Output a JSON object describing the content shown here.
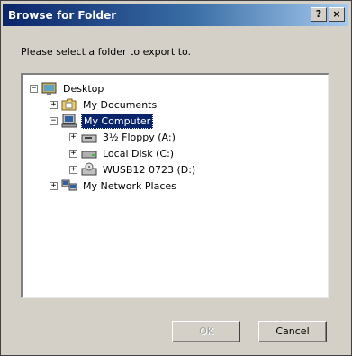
{
  "window": {
    "title": "Browse for Folder",
    "help_button": "?",
    "close_button": "×"
  },
  "prompt": "Please select a folder to export to.",
  "tree": {
    "desktop": {
      "label": "Desktop",
      "expander": "−"
    },
    "my_documents": {
      "label": "My Documents",
      "expander": "+"
    },
    "my_computer": {
      "label": "My Computer",
      "expander": "−",
      "selected": true
    },
    "floppy": {
      "label": "3½ Floppy (A:)",
      "expander": "+"
    },
    "local_disk": {
      "label": "Local Disk (C:)",
      "expander": "+"
    },
    "usb": {
      "label": "WUSB12 0723 (D:)",
      "expander": "+"
    },
    "network": {
      "label": "My Network Places",
      "expander": "+"
    }
  },
  "buttons": {
    "ok": "OK",
    "cancel": "Cancel"
  }
}
